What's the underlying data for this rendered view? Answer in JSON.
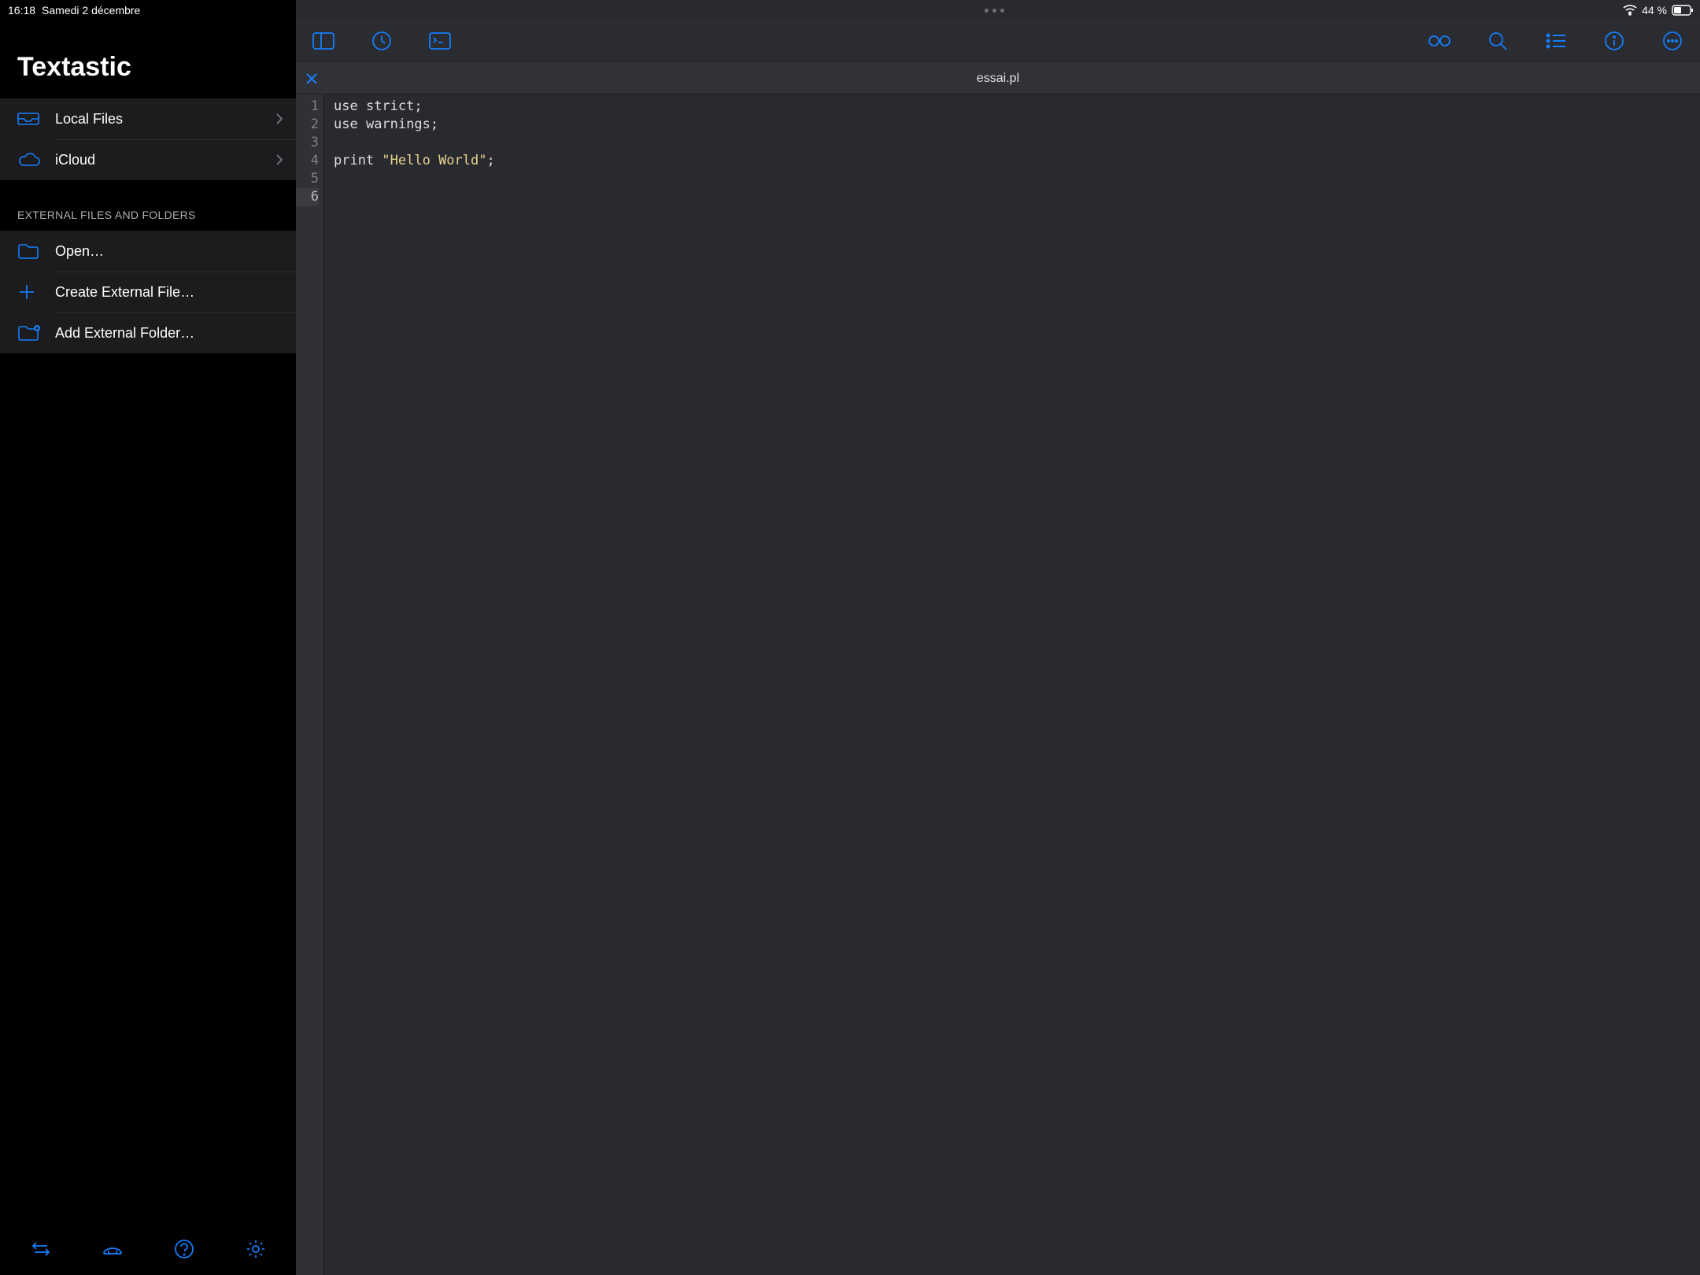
{
  "status": {
    "time": "16:18",
    "date": "Samedi 2 décembre",
    "battery": "44 %"
  },
  "app_title": "Textastic",
  "sidebar": {
    "storage": [
      {
        "label": "Local Files"
      },
      {
        "label": "iCloud"
      }
    ],
    "external_header": "EXTERNAL FILES AND FOLDERS",
    "external": [
      {
        "label": "Open…"
      },
      {
        "label": "Create External File…"
      },
      {
        "label": "Add External Folder…"
      }
    ]
  },
  "editor": {
    "filename": "essai.pl",
    "lines": [
      {
        "n": 1,
        "tokens": [
          {
            "t": "use ",
            "c": "kw"
          },
          {
            "t": "strict;",
            "c": "kw"
          }
        ]
      },
      {
        "n": 2,
        "tokens": [
          {
            "t": "use ",
            "c": "kw"
          },
          {
            "t": "warnings;",
            "c": "kw"
          }
        ]
      },
      {
        "n": 3,
        "tokens": []
      },
      {
        "n": 4,
        "tokens": [
          {
            "t": "print ",
            "c": "kw"
          },
          {
            "t": "\"Hello World\"",
            "c": "str"
          },
          {
            "t": ";",
            "c": "kw"
          }
        ]
      },
      {
        "n": 5,
        "tokens": []
      },
      {
        "n": 6,
        "tokens": [],
        "current": true
      }
    ]
  }
}
